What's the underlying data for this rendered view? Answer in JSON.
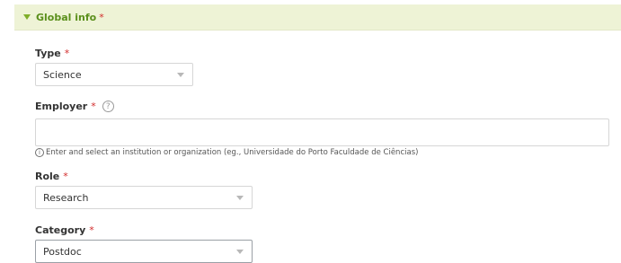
{
  "section": {
    "title": "Global info",
    "required_mark": "*"
  },
  "fields": {
    "type": {
      "label": "Type",
      "required_mark": "*",
      "value": "Science"
    },
    "employer": {
      "label": "Employer",
      "required_mark": "*",
      "help_glyph": "?",
      "value": "",
      "hint_glyph": "i",
      "hint": "Enter and select an institution or organization (eg., Universidade do Porto Faculdade de Ciências)"
    },
    "role": {
      "label": "Role",
      "required_mark": "*",
      "value": "Research"
    },
    "category": {
      "label": "Category",
      "required_mark": "*",
      "value": "Postdoc"
    }
  },
  "icons": {
    "section_caret": "caret-down-icon",
    "help": "question-circle-icon",
    "info": "info-circle-icon",
    "dropdown": "chevron-down-icon"
  },
  "colors": {
    "section_background": "#eef3d6",
    "section_title": "#5a8f1b",
    "required": "#d22b2b"
  }
}
